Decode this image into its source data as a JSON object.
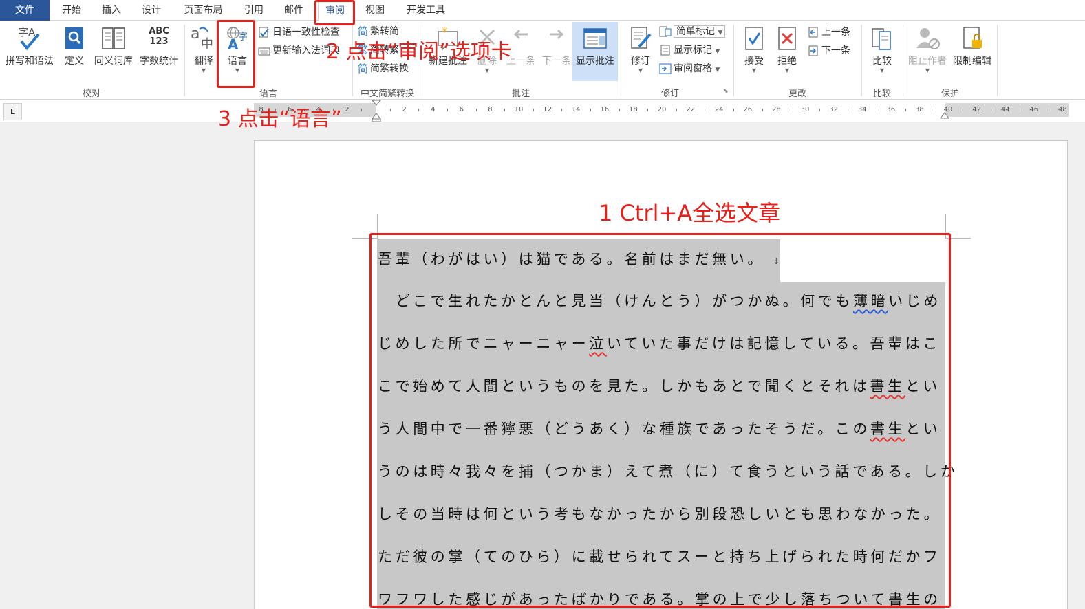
{
  "tabs": [
    "文件",
    "开始",
    "插入",
    "设计",
    "页面布局",
    "引用",
    "邮件",
    "审阅",
    "视图",
    "开发工具"
  ],
  "ribbon": {
    "proofing": {
      "spelling": "拼写和语法",
      "define": "定义",
      "thesaurus": "同义词库",
      "word_count": "字数统计",
      "word_count_icon_text": "ABC 123",
      "group": "校对"
    },
    "language": {
      "translate": "翻译",
      "language": "语言",
      "jp_consistency": "日语一致性检查",
      "update_ime": "更新输入法词典",
      "group": "语言"
    },
    "chinese": {
      "to_simplified": "繁转简",
      "to_traditional": "简转繁",
      "convert": "简繁转换",
      "group": "中文简繁转换"
    },
    "comments": {
      "new": "新建批注",
      "delete": "删除",
      "prev": "上一条",
      "next": "下一条",
      "show": "显示批注",
      "group": "批注"
    },
    "tracking": {
      "track": "修订",
      "markup": "简单标记",
      "show_markup": "显示标记",
      "pane": "审阅窗格",
      "group": "修订"
    },
    "changes": {
      "accept": "接受",
      "reject": "拒绝",
      "prev": "上一条",
      "next": "下一条",
      "group": "更改"
    },
    "compare": {
      "compare": "比较",
      "group": "比较"
    },
    "protect": {
      "block": "阻止作者",
      "restrict": "限制编辑",
      "group": "保护"
    }
  },
  "ruler": {
    "tab_selector": "L",
    "numbers": [
      "8",
      "6",
      "4",
      "2",
      "2",
      "4",
      "6",
      "8",
      "10",
      "12",
      "14",
      "16",
      "18",
      "20",
      "22",
      "24",
      "26",
      "28",
      "30",
      "32",
      "34",
      "36",
      "38",
      "40",
      "42",
      "44",
      "46",
      "48"
    ]
  },
  "document": {
    "lines": [
      "吾輩（わがはい）は猫である。名前はまだ無い。",
      "どこで生れたかとんと見当（けんとう）がつかぬ。何でも",
      "じめした所でニャーニャー",
      "こで始めて人間というものを見た。しかもあとで聞くとそれは",
      "う人間中で一番獰悪（どうあく）な種族であったそうだ。この",
      "うのは時々我々を捕（つかま）えて煮（に）て食うという話である。しか",
      "しその当時は何という考もなかったから別段恐しいとも思わなかった。",
      "ただ彼の掌（てのひら）に載せられてスーと持ち上げられた時何だかフ",
      "ワフワした感じがあったばかりである。掌の上で少し落ちついて書生の"
    ],
    "pilcrow": "↓",
    "line2_blue": "薄暗",
    "line2_tail": "いじめ",
    "line3_red": "泣",
    "line3_tail": "いていた事だけは記憶している。吾輩はこ",
    "line4_red": "書生",
    "line4_tail": "とい",
    "line5_red": "書生",
    "line5_tail": "とい"
  },
  "annotations": {
    "step1": "1 Ctrl+A全选文章",
    "step2": "2 点击“审阅”选项卡",
    "step3": "3 点击“语言”"
  },
  "colors": {
    "accent": "#2b579a",
    "annotation": "#e8201b",
    "selection": "#c8c8c8"
  }
}
